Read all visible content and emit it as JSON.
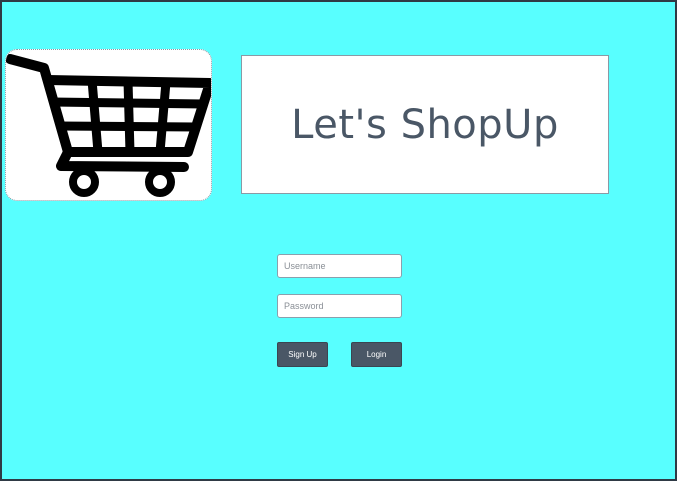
{
  "logo": {
    "icon": "shopping-cart-icon"
  },
  "header": {
    "title": "Let's ShopUp"
  },
  "form": {
    "username_placeholder": "Username",
    "username_value": "",
    "password_placeholder": "Password",
    "password_value": "",
    "signup_label": "Sign Up",
    "login_label": "Login"
  },
  "colors": {
    "background": "#58ffff",
    "button": "#4a5766",
    "title_text": "#4a5766"
  }
}
